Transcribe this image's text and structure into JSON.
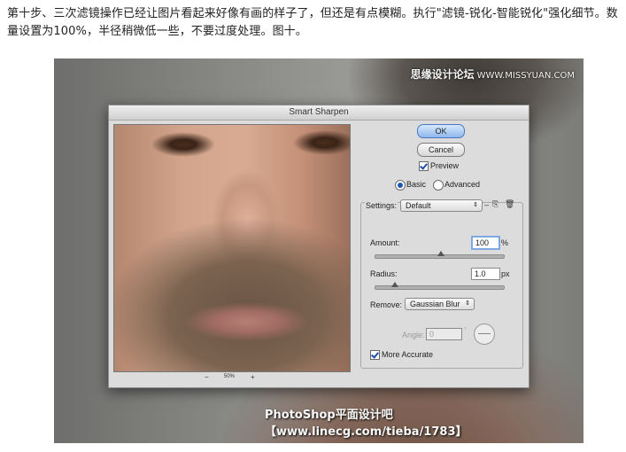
{
  "article": {
    "text": "第十步、三次滤镜操作已经让图片看起来好像有画的样子了，但还是有点模糊。执行\"滤镜-锐化-智能锐化\"强化细节。数量设置为100%，半径稍微低一些，不要过度处理。图十。"
  },
  "photo": {
    "watermark_top_big": "思缘设计论坛",
    "watermark_top_small": "WWW.MISSYUAN.COM",
    "watermark_bottom": "PhotoShop平面设计吧【www.linecg.com/tieba/1783】"
  },
  "dialog": {
    "title": "Smart Sharpen",
    "ok_label": "OK",
    "cancel_label": "Cancel",
    "preview_label": "Preview",
    "mode_basic": "Basic",
    "mode_advanced": "Advanced",
    "settings_label": "Settings:",
    "settings_value": "Default",
    "amount_label": "Amount:",
    "amount_value": "100",
    "amount_unit": "%",
    "amount_level": 0.5,
    "radius_label": "Radius:",
    "radius_value": "1.0",
    "radius_unit": "px",
    "radius_level": 0.15,
    "remove_label": "Remove:",
    "remove_value": "Gaussian Blur",
    "angle_label": "Angle:",
    "angle_value": "0",
    "angle_unit": "°",
    "more_accurate_label": "More Accurate",
    "zoom_out": "−",
    "zoom_value": "50%",
    "zoom_in": "+"
  }
}
